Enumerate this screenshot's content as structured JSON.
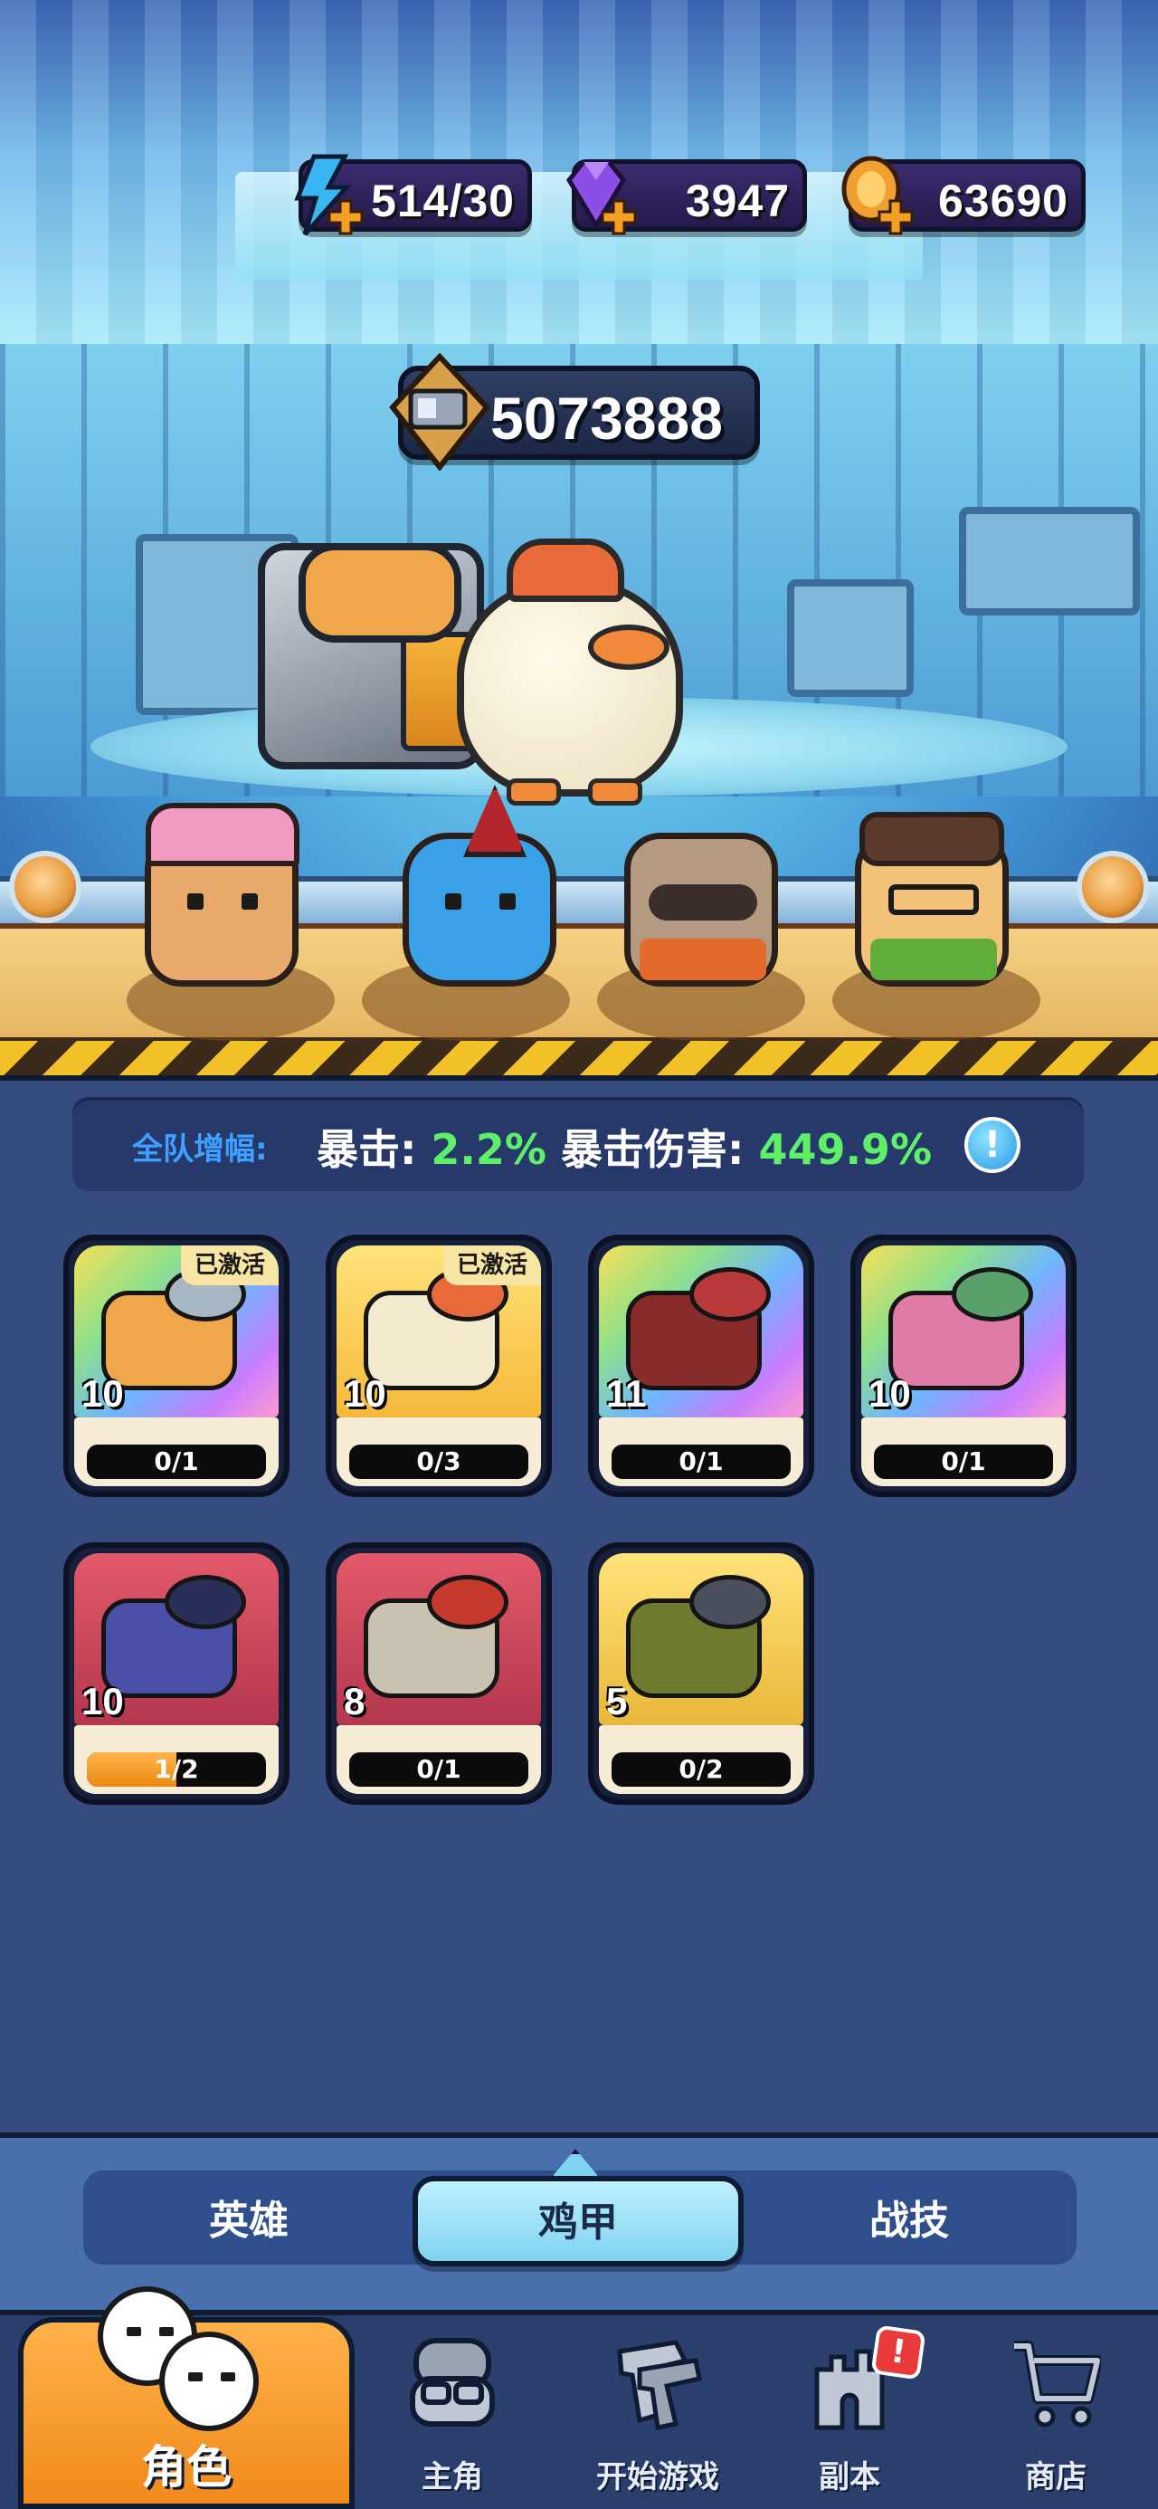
{
  "resources": {
    "energy": {
      "value": "514/30",
      "icon": "lightning-icon",
      "color": "#3ab6f2"
    },
    "gems": {
      "value": "3947",
      "icon": "gem-icon",
      "color": "#8b4ee6"
    },
    "coins": {
      "value": "63690",
      "icon": "coin-icon",
      "color": "#f0a030"
    }
  },
  "power": {
    "value": "5073888",
    "icon": "power-icon"
  },
  "bonus": {
    "label": "全队增幅:",
    "crit_label": "暴击: ",
    "crit_value": "2.2%",
    "crit_dmg_label": " 暴击伤害: ",
    "crit_dmg_value": "449.9%",
    "info": "!"
  },
  "mechs": [
    {
      "level": "10",
      "progress": "0/1",
      "fill": 0,
      "badge": "已激活",
      "bg": "linear-gradient(135deg,#f6e05a 0%,#8fe08a 30%,#6fb6ff 55%,#c77dff 80%,#ff9ad1 100%)",
      "c1": "#f0a64a",
      "c2": "#a9b6c4"
    },
    {
      "level": "10",
      "progress": "0/3",
      "fill": 0,
      "badge": "已激活",
      "bg": "linear-gradient(180deg,#ffe37a 0%,#f6b93a 100%)",
      "c1": "#f3ead0",
      "c2": "#e86a3b"
    },
    {
      "level": "11",
      "progress": "0/1",
      "fill": 0,
      "badge": "",
      "bg": "linear-gradient(135deg,#f6e05a 0%,#8fe08a 30%,#6fb6ff 55%,#c77dff 80%,#ff9ad1 100%)",
      "c1": "#8a2b2b",
      "c2": "#b93a3a"
    },
    {
      "level": "10",
      "progress": "0/1",
      "fill": 0,
      "badge": "",
      "bg": "linear-gradient(135deg,#f6e05a 0%,#8fe08a 30%,#6fb6ff 55%,#c77dff 80%,#ff9ad1 100%)",
      "c1": "#e07aa6",
      "c2": "#5aa06a"
    },
    {
      "level": "10",
      "progress": "1/2",
      "fill": 0.5,
      "badge": "",
      "bg": "linear-gradient(180deg,#e35a6a 0%,#b3374e 100%)",
      "c1": "#4a4fa8",
      "c2": "#2a2f5a"
    },
    {
      "level": "8",
      "progress": "0/1",
      "fill": 0,
      "badge": "",
      "bg": "linear-gradient(180deg,#e35a6a 0%,#b3374e 100%)",
      "c1": "#c9c2b0",
      "c2": "#c5392f"
    },
    {
      "level": "5",
      "progress": "0/2",
      "fill": 0,
      "badge": "",
      "bg": "linear-gradient(180deg,#ffe37a 0%,#e9b73a 100%)",
      "c1": "#6f7a2e",
      "c2": "#4a4f5e"
    }
  ],
  "tabs": [
    {
      "label": "英雄",
      "active": false
    },
    {
      "label": "鸡甲",
      "active": true
    },
    {
      "label": "战技",
      "active": false
    }
  ],
  "nav": {
    "active": "角色",
    "items": [
      {
        "label": "主角",
        "icon": "hero-face-icon"
      },
      {
        "label": "开始游戏",
        "icon": "guns-icon"
      },
      {
        "label": "副本",
        "icon": "castle-icon",
        "alert": "!"
      },
      {
        "label": "商店",
        "icon": "cart-icon"
      }
    ]
  }
}
